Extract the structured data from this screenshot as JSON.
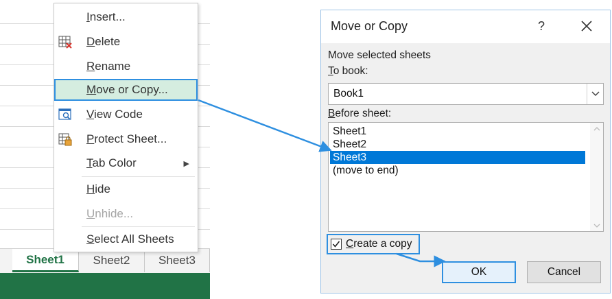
{
  "sheet_area": {
    "tabs": [
      {
        "label": "Sheet1",
        "active": true
      },
      {
        "label": "Sheet2",
        "active": false
      },
      {
        "label": "Sheet3",
        "active": false
      }
    ],
    "status_bar_color": "#217346"
  },
  "context_menu": {
    "items": [
      {
        "label": "Insert...",
        "icon": null,
        "disabled": false
      },
      {
        "label": "Delete",
        "icon": "delete-sheet-icon",
        "disabled": false
      },
      {
        "label": "Rename",
        "icon": null,
        "disabled": false
      },
      {
        "label": "Move or Copy...",
        "icon": null,
        "disabled": false,
        "highlighted": true
      },
      {
        "label": "View Code",
        "icon": "view-code-icon",
        "disabled": false
      },
      {
        "label": "Protect Sheet...",
        "icon": "protect-sheet-icon",
        "disabled": false
      },
      {
        "label": "Tab Color",
        "icon": null,
        "disabled": false,
        "submenu": true
      },
      {
        "label": "Hide",
        "icon": null,
        "disabled": false
      },
      {
        "label": "Unhide...",
        "icon": null,
        "disabled": true
      },
      {
        "label": "Select All Sheets",
        "icon": null,
        "disabled": false
      }
    ],
    "highlight_color": "#d5ede0"
  },
  "dialog": {
    "title": "Move or Copy",
    "help_label": "?",
    "move_selected_label": "Move selected sheets",
    "to_book_label": "To book:",
    "to_book_value": "Book1",
    "before_sheet_label": "Before sheet:",
    "sheets": [
      "Sheet1",
      "Sheet2",
      "Sheet3",
      "(move to end)"
    ],
    "selected_sheet": "Sheet3",
    "create_copy_label": "Create a copy",
    "create_copy_checked": true,
    "ok_label": "OK",
    "cancel_label": "Cancel",
    "selection_color": "#0078d7",
    "annotation_color": "#2e8fe0"
  }
}
